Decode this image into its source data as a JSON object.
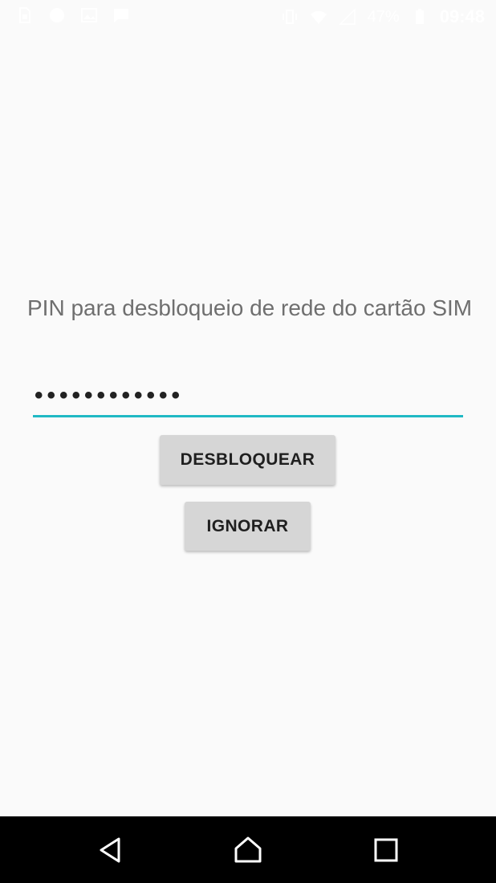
{
  "status_bar": {
    "battery_percent": "47%",
    "time": "09:48",
    "left_icons": [
      "sim-icon",
      "circle-notification-icon",
      "image-icon",
      "message-icon"
    ],
    "right_icons": [
      "vibrate-icon",
      "wifi-icon",
      "no-signal-icon",
      "battery-icon"
    ]
  },
  "sim_unlock": {
    "prompt": "PIN para desbloqueio de rede do cartão SIM",
    "pin_masked": "••••••••••••",
    "unlock_label": "DESBLOQUEAR",
    "ignore_label": "IGNORAR"
  },
  "navigation": {
    "back_icon": "back-icon",
    "home_icon": "home-icon",
    "recents_icon": "recents-icon"
  },
  "colors": {
    "accent": "#20b9c4",
    "background": "#fafafa",
    "button": "#d6d6d6",
    "nav_bar": "#000000"
  }
}
